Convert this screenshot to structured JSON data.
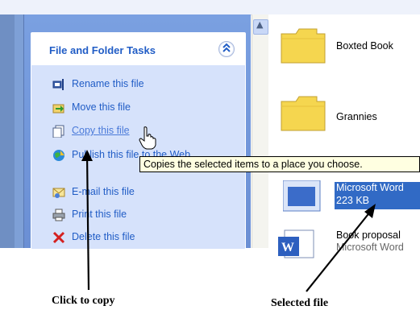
{
  "task_panel": {
    "title": "File and Folder Tasks",
    "collapse_glyph": "⌃",
    "tasks": [
      {
        "label": "Rename this file",
        "icon": "rename-icon"
      },
      {
        "label": "Move this file",
        "icon": "move-icon"
      },
      {
        "label": "Copy this file",
        "icon": "copy-icon"
      },
      {
        "label": "Publish this file to the Web",
        "icon": "publish-icon"
      },
      {
        "label": "E-mail this file",
        "icon": "email-icon"
      },
      {
        "label": "Print this file",
        "icon": "print-icon"
      },
      {
        "label": "Delete this file",
        "icon": "delete-icon"
      }
    ]
  },
  "tooltip": {
    "text": "Copies the selected items to a place you choose."
  },
  "files": [
    {
      "name": "Boxted Book",
      "type": "folder"
    },
    {
      "name": "Grannies",
      "type": "folder"
    },
    {
      "name": "Microsoft Word",
      "size": "223 KB",
      "type": "word-document",
      "selected": true
    },
    {
      "name": "Book proposal",
      "subtitle": "Microsoft Word",
      "type": "word-document"
    }
  ],
  "annotations": {
    "left": "Click to copy",
    "right": "Selected file"
  },
  "colors": {
    "task_link": "#215dc6",
    "selection": "#316ac5",
    "tooltip_bg": "#ffffe1",
    "pane_blue": "#7aa0e1"
  }
}
